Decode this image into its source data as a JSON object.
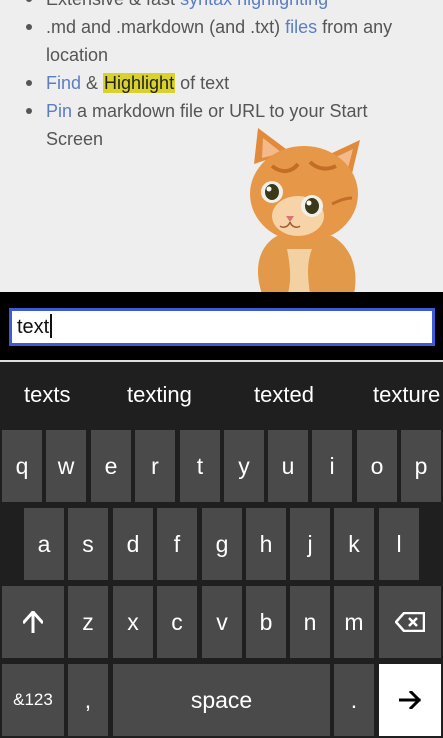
{
  "document": {
    "bullets": [
      {
        "parts": [
          {
            "text": "Extensive & fast ",
            "style": "plain"
          },
          {
            "text": "syntax highlighting",
            "style": "link"
          }
        ]
      },
      {
        "parts": [
          {
            "text": ".md and .markdown (and .txt) ",
            "style": "plain"
          },
          {
            "text": "files",
            "style": "link"
          },
          {
            "text": " from any location",
            "style": "plain"
          }
        ]
      },
      {
        "parts": [
          {
            "text": "Find",
            "style": "link"
          },
          {
            "text": " & ",
            "style": "plain"
          },
          {
            "text": "Highlight",
            "style": "highlight"
          },
          {
            "text": " of text",
            "style": "plain"
          }
        ]
      },
      {
        "parts": [
          {
            "text": "Pin",
            "style": "link"
          },
          {
            "text": " a markdown file or URL to your Start Screen",
            "style": "plain"
          }
        ]
      }
    ]
  },
  "search": {
    "value": "text"
  },
  "suggestions": [
    "texts",
    "texting",
    "texted",
    "texture"
  ],
  "keyboard": {
    "row1": [
      "q",
      "w",
      "e",
      "r",
      "t",
      "y",
      "u",
      "i",
      "o",
      "p"
    ],
    "row2": [
      "a",
      "s",
      "d",
      "f",
      "g",
      "h",
      "j",
      "k",
      "l"
    ],
    "row3": [
      "z",
      "x",
      "c",
      "v",
      "b",
      "n",
      "m"
    ],
    "symbols_label": "&123",
    "comma_label": ",",
    "space_label": "space",
    "period_label": ".",
    "shift_icon": "shift-arrow-icon",
    "backspace_icon": "backspace-icon",
    "enter_icon": "enter-arrow-icon"
  },
  "colors": {
    "link": "#5b7ec2",
    "highlight": "#d9d22c",
    "input_border": "#3c5bd5",
    "key": "#4a4a4a",
    "keyboard_bg": "#1f1f1f"
  }
}
